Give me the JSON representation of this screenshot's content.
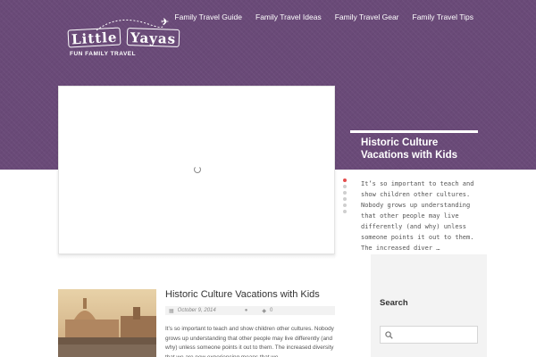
{
  "logo": {
    "word1": "Little",
    "word2": "Yayas",
    "tagline": "FUN FAMILY TRAVEL",
    "plane_icon": "airplane-icon"
  },
  "nav": {
    "items": [
      {
        "label": "Family Travel Guide"
      },
      {
        "label": "Family Travel Ideas"
      },
      {
        "label": "Family Travel Gear"
      },
      {
        "label": "Family Travel Tips"
      }
    ]
  },
  "featured": {
    "title": "Historic Culture Vacations with Kids",
    "excerpt": "It’s so important to teach and show children other cultures. Nobody grows up understanding that other people may live differently (and why) unless someone points it out to them. The increased diver …",
    "dots_total": 6,
    "active_dot": 1
  },
  "post": {
    "title": "Historic Culture Vacations with Kids",
    "date": "October 9, 2014",
    "comments": "0",
    "excerpt": "It’s so important to teach and show children other cultures. Nobody grows up understanding that other people may live differently (and why) unless someone points it out to them. The increased diversity that we are now experiencing means that we"
  },
  "sidebar": {
    "search_title": "Search",
    "search_placeholder": ""
  },
  "colors": {
    "header_purple": "#6a4a78",
    "accent_red": "#e44d4d"
  },
  "icons": {
    "calendar": "calendar-icon",
    "author": "user-icon",
    "comments": "comment-icon",
    "search": "search-icon",
    "loading": "loading-spinner-icon"
  }
}
